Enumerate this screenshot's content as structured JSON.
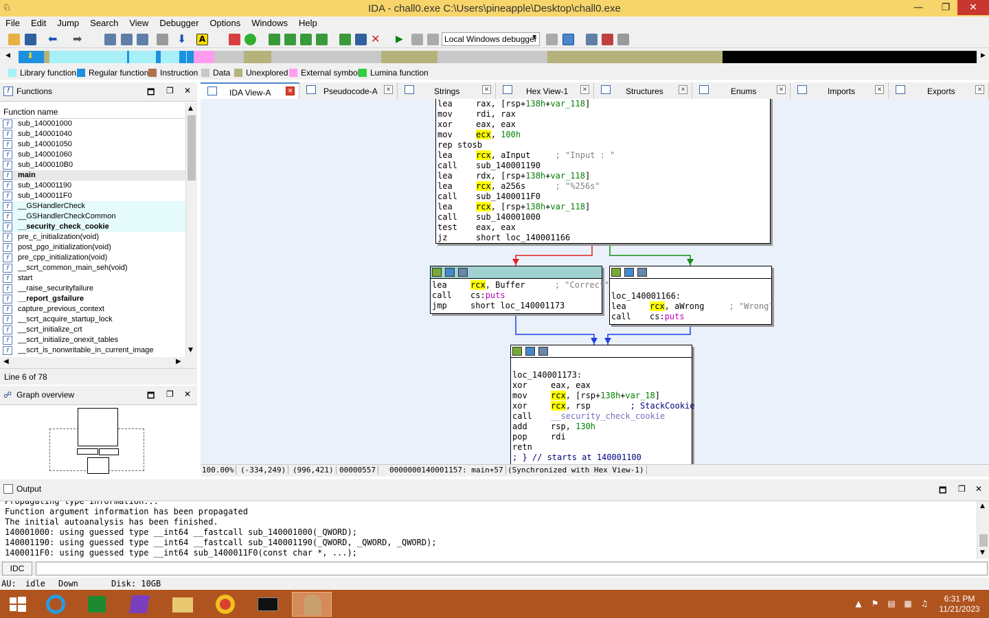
{
  "window": {
    "title": "IDA - chall0.exe C:\\Users\\pineapple\\Desktop\\chall0.exe",
    "min_glyph": "—",
    "restore_glyph": "❐",
    "close_glyph": "✕"
  },
  "menu": [
    "File",
    "Edit",
    "Jump",
    "Search",
    "View",
    "Debugger",
    "Options",
    "Windows",
    "Help"
  ],
  "toolbar": {
    "debugger_select": "Local Windows debugger"
  },
  "legend": [
    {
      "label": "Library function",
      "color": "#a8f0f8"
    },
    {
      "label": "Regular function",
      "color": "#1e90e0"
    },
    {
      "label": "Instruction",
      "color": "#b07050"
    },
    {
      "label": "Data",
      "color": "#c8c8c8"
    },
    {
      "label": "Unexplored",
      "color": "#b5b27a"
    },
    {
      "label": "External symbol",
      "color": "#ff9cf0"
    },
    {
      "label": "Lumina function",
      "color": "#30d040"
    }
  ],
  "functions_panel": {
    "title": "Functions",
    "column": "Function name",
    "status": "Line 6 of 78",
    "items": [
      {
        "name": "sub_140001000",
        "kind": "normal"
      },
      {
        "name": "sub_140001040",
        "kind": "normal"
      },
      {
        "name": "sub_140001050",
        "kind": "normal"
      },
      {
        "name": "sub_140001060",
        "kind": "normal"
      },
      {
        "name": "sub_1400010B0",
        "kind": "normal"
      },
      {
        "name": "main",
        "kind": "selected"
      },
      {
        "name": "sub_140001190",
        "kind": "normal"
      },
      {
        "name": "sub_1400011F0",
        "kind": "normal"
      },
      {
        "name": "__GSHandlerCheck",
        "kind": "lib"
      },
      {
        "name": "__GSHandlerCheckCommon",
        "kind": "lib"
      },
      {
        "name": "__security_check_cookie",
        "kind": "libbold"
      },
      {
        "name": "pre_c_initialization(void)",
        "kind": "normal"
      },
      {
        "name": "post_pgo_initialization(void)",
        "kind": "normal"
      },
      {
        "name": "pre_cpp_initialization(void)",
        "kind": "normal"
      },
      {
        "name": "__scrt_common_main_seh(void)",
        "kind": "normal"
      },
      {
        "name": "start",
        "kind": "normal"
      },
      {
        "name": "__raise_securityfailure",
        "kind": "normal"
      },
      {
        "name": "__report_gsfailure",
        "kind": "bold"
      },
      {
        "name": "capture_previous_context",
        "kind": "normal"
      },
      {
        "name": "__scrt_acquire_startup_lock",
        "kind": "normal"
      },
      {
        "name": "__scrt_initialize_crt",
        "kind": "normal"
      },
      {
        "name": "__scrt_initialize_onexit_tables",
        "kind": "normal"
      },
      {
        "name": "__scrt_is_nonwritable_in_current_image",
        "kind": "normal"
      }
    ]
  },
  "graph_overview": {
    "title": "Graph overview"
  },
  "tabs": [
    {
      "label": "IDA View-A",
      "active": true
    },
    {
      "label": "Pseudocode-A",
      "active": false
    },
    {
      "label": "Strings",
      "active": false
    },
    {
      "label": "Hex View-1",
      "active": false
    },
    {
      "label": "Structures",
      "active": false
    },
    {
      "label": "Enums",
      "active": false
    },
    {
      "label": "Imports",
      "active": false
    },
    {
      "label": "Exports",
      "active": false
    }
  ],
  "blocks": {
    "main": [
      [
        "lea",
        [
          [
            "t",
            "rax, [rsp+"
          ],
          [
            "g",
            "138h"
          ],
          [
            "t",
            "+"
          ],
          [
            "g",
            "var_118"
          ],
          [
            "t",
            "]"
          ]
        ]
      ],
      [
        "mov",
        [
          [
            "t",
            "rdi, rax"
          ]
        ]
      ],
      [
        "xor",
        [
          [
            "t",
            "eax, eax"
          ]
        ]
      ],
      [
        "mov",
        [
          [
            "h",
            "ecx"
          ],
          [
            "t",
            ", "
          ],
          [
            "g",
            "100h"
          ]
        ]
      ],
      [
        "rep stosb",
        []
      ],
      [
        "lea",
        [
          [
            "h",
            "rcx"
          ],
          [
            "t",
            ", aInput     "
          ],
          [
            "c",
            "; \"Input : \""
          ]
        ]
      ],
      [
        "call",
        [
          [
            "t",
            "sub_140001190"
          ]
        ]
      ],
      [
        "lea",
        [
          [
            "t",
            "rdx, [rsp+"
          ],
          [
            "g",
            "138h"
          ],
          [
            "t",
            "+"
          ],
          [
            "g",
            "var_118"
          ],
          [
            "t",
            "]"
          ]
        ]
      ],
      [
        "lea",
        [
          [
            "h",
            "rcx"
          ],
          [
            "t",
            ", a256s      "
          ],
          [
            "c",
            "; \"%256s\""
          ]
        ]
      ],
      [
        "call",
        [
          [
            "t",
            "sub_1400011F0"
          ]
        ]
      ],
      [
        "lea",
        [
          [
            "h",
            "rcx"
          ],
          [
            "t",
            ", [rsp+"
          ],
          [
            "g",
            "138h"
          ],
          [
            "t",
            "+"
          ],
          [
            "g",
            "var_118"
          ],
          [
            "t",
            "]"
          ]
        ]
      ],
      [
        "call",
        [
          [
            "t",
            "sub_140001000"
          ]
        ]
      ],
      [
        "test",
        [
          [
            "t",
            "eax, eax"
          ]
        ]
      ],
      [
        "jz",
        [
          [
            "t",
            "short loc_140001166"
          ]
        ]
      ]
    ],
    "correct": [
      [
        "lea",
        [
          [
            "h",
            "rcx"
          ],
          [
            "t",
            ", Buffer      "
          ],
          [
            "c",
            "; \"Correct\""
          ]
        ]
      ],
      [
        "call",
        [
          [
            "t",
            "cs:"
          ],
          [
            "m",
            "puts"
          ]
        ]
      ],
      [
        "jmp",
        [
          [
            "t",
            "short loc_140001173"
          ]
        ]
      ]
    ],
    "wrong_label": "loc_140001166:",
    "wrong": [
      [
        "lea",
        [
          [
            "h",
            "rcx"
          ],
          [
            "t",
            ", aWrong     "
          ],
          [
            "c",
            "; \"Wrong\""
          ]
        ]
      ],
      [
        "call",
        [
          [
            "t",
            "cs:"
          ],
          [
            "m",
            "puts"
          ]
        ]
      ]
    ],
    "exit_label": "loc_140001173:",
    "exit": [
      [
        "xor",
        [
          [
            "t",
            "eax, eax"
          ]
        ]
      ],
      [
        "mov",
        [
          [
            "h",
            "rcx"
          ],
          [
            "t",
            ", [rsp+"
          ],
          [
            "g",
            "138h"
          ],
          [
            "t",
            "+"
          ],
          [
            "g",
            "var_18"
          ],
          [
            "t",
            "]"
          ]
        ]
      ],
      [
        "xor",
        [
          [
            "h",
            "rcx"
          ],
          [
            "t",
            ", rsp        "
          ],
          [
            "b",
            "; StackCookie"
          ]
        ]
      ],
      [
        "call",
        [
          [
            "p",
            "__security_check_cookie"
          ]
        ]
      ],
      [
        "add",
        [
          [
            "t",
            "rsp, "
          ],
          [
            "g",
            "130h"
          ]
        ]
      ],
      [
        "pop",
        [
          [
            "t",
            "rdi"
          ]
        ]
      ],
      [
        "retn",
        []
      ]
    ],
    "exit_footer": "; } // starts at 140001100"
  },
  "graph_status": [
    "100.00%",
    "(-334,249)",
    "(996,421)",
    "00000557",
    "0000000140001157: main+57",
    "(Synchronized with Hex View-1)"
  ],
  "output": {
    "title": "Output",
    "lines": [
      "Propagating type information...",
      "Function argument information has been propagated",
      "The initial autoanalysis has been finished.",
      "140001000: using guessed type __int64 __fastcall sub_140001000(_QWORD);",
      "140001190: using guessed type __int64 __fastcall sub_140001190(_QWORD, _QWORD, _QWORD);",
      "1400011F0: using guessed type __int64 sub_1400011F0(const char *, ...);"
    ]
  },
  "idc": {
    "button": "IDC"
  },
  "ida_status": {
    "au": "AU:",
    "state": "idle",
    "dir": "Down",
    "disk": "Disk: 10GB"
  },
  "clock": {
    "time": "6:31 PM",
    "date": "11/21/2023"
  }
}
